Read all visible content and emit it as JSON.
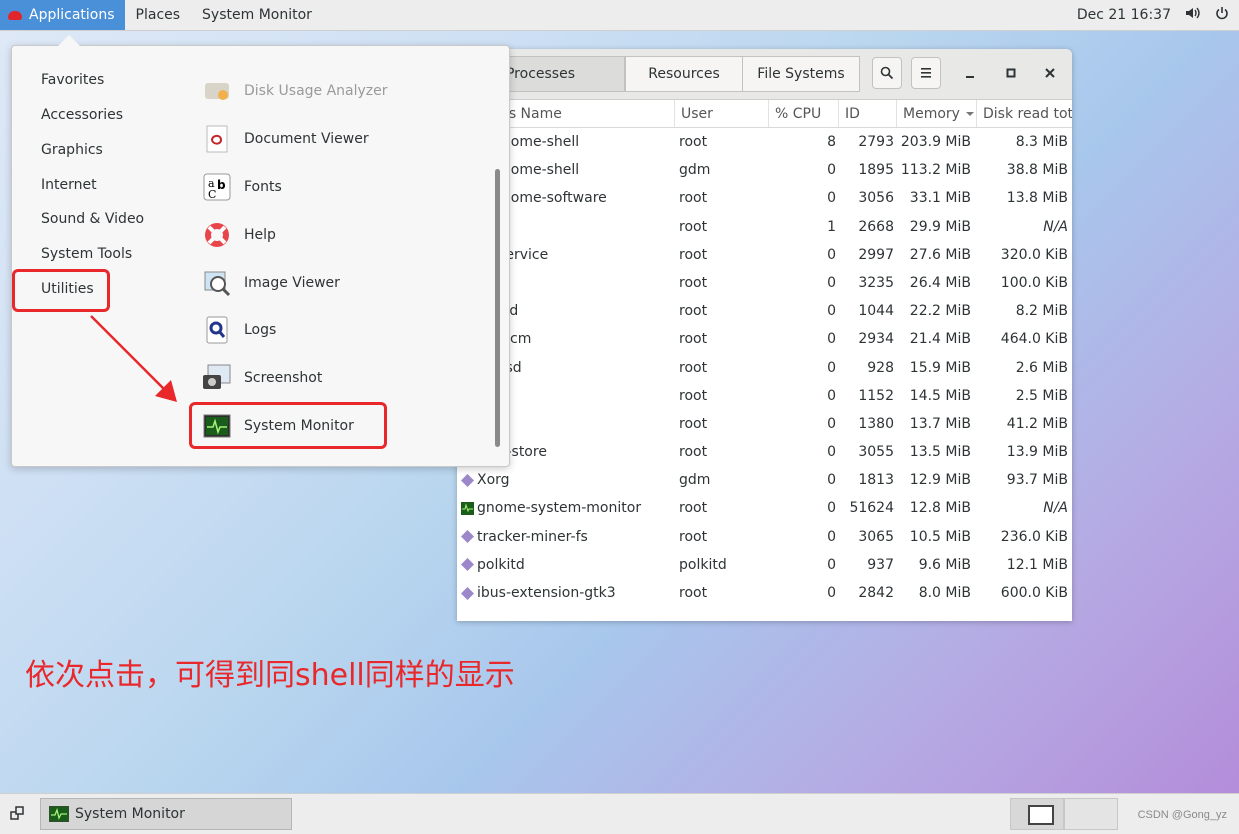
{
  "topbar": {
    "applications": "Applications",
    "places": "Places",
    "app_name": "System Monitor",
    "clock": "Dec 21 16:37"
  },
  "menu": {
    "categories": [
      "Favorites",
      "Accessories",
      "Graphics",
      "Internet",
      "Sound & Video",
      "System Tools",
      "Utilities"
    ],
    "apps": [
      "Disk Usage Analyzer",
      "Document Viewer",
      "Fonts",
      "Help",
      "Image Viewer",
      "Logs",
      "Screenshot",
      "System Monitor"
    ]
  },
  "monitor": {
    "tabs": [
      "Processes",
      "Resources",
      "File Systems"
    ],
    "columns": [
      "Process Name",
      "User",
      "% CPU",
      "ID",
      "Memory",
      "Disk read total"
    ],
    "rows": [
      {
        "name": "gnome-shell",
        "user": "root",
        "cpu": "8",
        "id": "2793",
        "mem": "203.9 MiB",
        "disk": "8.3 MiB"
      },
      {
        "name": "gnome-shell",
        "user": "gdm",
        "cpu": "0",
        "id": "1895",
        "mem": "113.2 MiB",
        "disk": "38.8 MiB"
      },
      {
        "name": "gnome-software",
        "user": "root",
        "cpu": "0",
        "id": "3056",
        "mem": "33.1 MiB",
        "disk": "13.8 MiB"
      },
      {
        "name": "",
        "user": "root",
        "cpu": "1",
        "id": "2668",
        "mem": "29.9 MiB",
        "disk": "N/A"
      },
      {
        "name": "-service",
        "user": "root",
        "cpu": "0",
        "id": "2997",
        "mem": "27.6 MiB",
        "disk": "320.0 KiB"
      },
      {
        "name": "d",
        "user": "root",
        "cpu": "0",
        "id": "3235",
        "mem": "26.4 MiB",
        "disk": "100.0 KiB"
      },
      {
        "name": "alld",
        "user": "root",
        "cpu": "0",
        "id": "1044",
        "mem": "22.2 MiB",
        "disk": "8.2 MiB"
      },
      {
        "name": "1kcm",
        "user": "root",
        "cpu": "0",
        "id": "2934",
        "mem": "21.4 MiB",
        "disk": "464.0 KiB"
      },
      {
        "name": "olsd",
        "user": "root",
        "cpu": "0",
        "id": "928",
        "mem": "15.9 MiB",
        "disk": "2.6 MiB"
      },
      {
        "name": "d",
        "user": "root",
        "cpu": "0",
        "id": "1152",
        "mem": "14.5 MiB",
        "disk": "2.5 MiB"
      },
      {
        "name": "td",
        "user": "root",
        "cpu": "0",
        "id": "1380",
        "mem": "13.7 MiB",
        "disk": "41.2 MiB"
      },
      {
        "name": "er-store",
        "user": "root",
        "cpu": "0",
        "id": "3055",
        "mem": "13.5 MiB",
        "disk": "13.9 MiB"
      },
      {
        "name": "Xorg",
        "user": "gdm",
        "cpu": "0",
        "id": "1813",
        "mem": "12.9 MiB",
        "disk": "93.7 MiB"
      },
      {
        "name": "gnome-system-monitor",
        "user": "root",
        "cpu": "0",
        "id": "51624",
        "mem": "12.8 MiB",
        "disk": "N/A"
      },
      {
        "name": "tracker-miner-fs",
        "user": "root",
        "cpu": "0",
        "id": "3065",
        "mem": "10.5 MiB",
        "disk": "236.0 KiB"
      },
      {
        "name": "polkitd",
        "user": "polkitd",
        "cpu": "0",
        "id": "937",
        "mem": "9.6 MiB",
        "disk": "12.1 MiB"
      },
      {
        "name": "ibus-extension-gtk3",
        "user": "root",
        "cpu": "0",
        "id": "2842",
        "mem": "8.0 MiB",
        "disk": "600.0 KiB"
      }
    ]
  },
  "annotation": "依次点击，可得到同shell同样的显示",
  "taskbar": {
    "task": "System Monitor",
    "credit": "CSDN @Gong_yz"
  },
  "colors": {
    "highlight": "#e8282b",
    "accent": "#4a90d9"
  }
}
